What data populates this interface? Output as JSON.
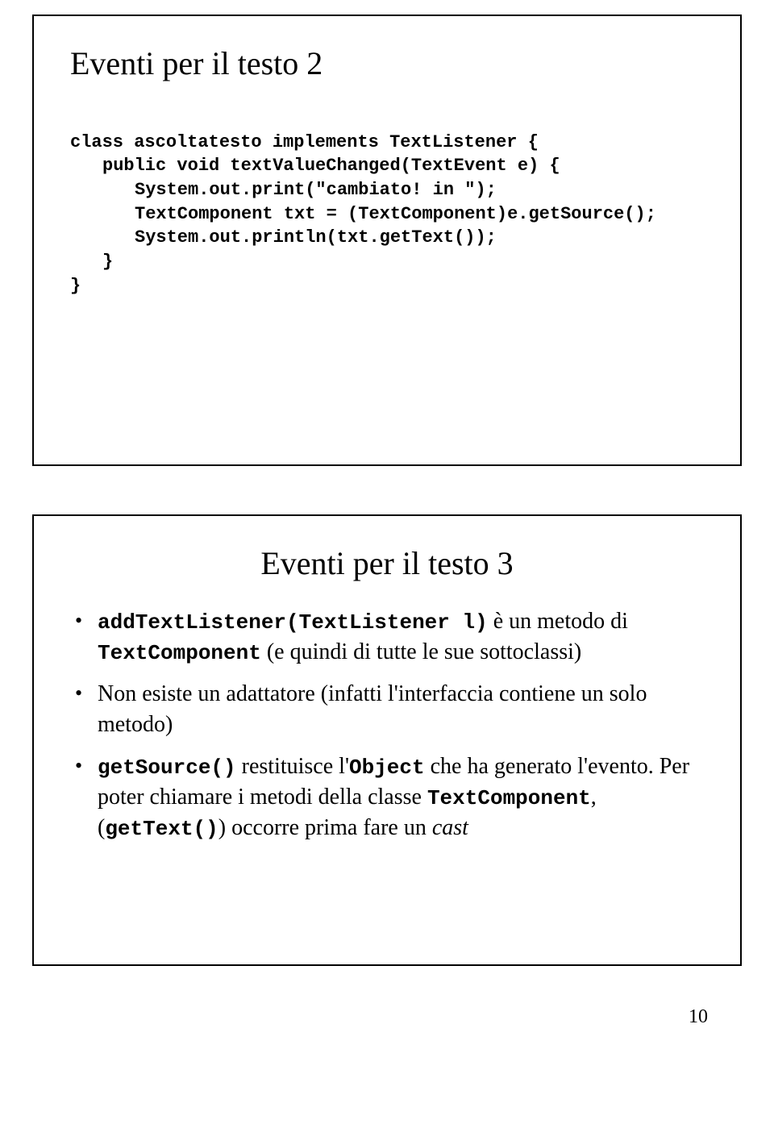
{
  "slide1": {
    "title": "Eventi per il testo 2",
    "code": {
      "l1": "class ascoltatesto implements TextListener {",
      "l2": "public void textValueChanged(TextEvent e) {",
      "l3": "System.out.print(\"cambiato! in \");",
      "l4": "TextComponent txt = (TextComponent)e.getSource();",
      "l5": "System.out.println(txt.getText());",
      "l6": "}",
      "l7": "}"
    }
  },
  "slide2": {
    "title": "Eventi per il testo 3",
    "bullets": {
      "b1": {
        "code1": "addTextListener(TextListener l)",
        "t1": " è un metodo di ",
        "code2": "TextComponent",
        "t2": " (e quindi di tutte le sue sottoclassi)"
      },
      "b2": "Non esiste un adattatore (infatti l'interfaccia contiene un solo metodo)",
      "b3": {
        "code1": "getSource()",
        "t1": " restituisce l'",
        "code2": "Object",
        "t2": " che ha generato l'evento. Per poter chiamare i metodi della classe ",
        "code3": "TextComponent",
        "t3": ", (",
        "code4": "getText()",
        "t4": ") occorre prima fare un ",
        "em": "cast"
      }
    }
  },
  "pageNumber": "10"
}
